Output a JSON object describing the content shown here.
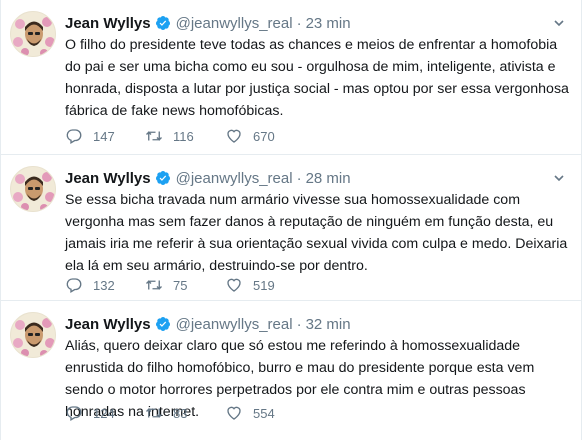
{
  "tweets": [
    {
      "name": "Jean Wyllys",
      "handle": "@jeanwyllys_real",
      "separator": "·",
      "time": "23 min",
      "text": "O filho do presidente teve todas as chances e meios de enfrentar a homofobia do pai e ser uma bicha como eu sou - orgulhosa de mim, inteligente, ativista e honrada, disposta a lutar por justiça social  - mas optou por ser essa vergonhosa fábrica de fake news homofóbicas.",
      "replies": "147",
      "retweets": "116",
      "likes": "670"
    },
    {
      "name": "Jean Wyllys",
      "handle": "@jeanwyllys_real",
      "separator": "·",
      "time": "28 min",
      "text": "Se essa bicha travada num armário vivesse sua homossexualidade com vergonha mas sem fazer danos à reputação de ninguém em função desta, eu jamais iria me referir à sua orientação sexual vivida com culpa e medo. Deixaria ela lá em seu armário, destruindo-se por dentro.",
      "replies": "132",
      "retweets": "75",
      "likes": "519"
    },
    {
      "name": "Jean Wyllys",
      "handle": "@jeanwyllys_real",
      "separator": "·",
      "time": "32 min",
      "text": "Aliás, quero deixar claro que só estou me referindo à homossexualidade enrustida do filho homofóbico, burro e mau do presidente porque esta vem sendo o motor horrores perpetrados por ele contra mim e outras pessoas honradas na internet.",
      "replies": "124",
      "retweets": "83",
      "likes": "554"
    }
  ],
  "icons": {
    "reply": "reply-icon",
    "retweet": "retweet-icon",
    "like": "heart-icon",
    "verified": "verified-badge-icon",
    "more": "chevron-down-icon"
  },
  "colors": {
    "text": "#14171a",
    "secondary": "#657786",
    "verified": "#1da1f2",
    "divider": "#e6ecf0"
  }
}
